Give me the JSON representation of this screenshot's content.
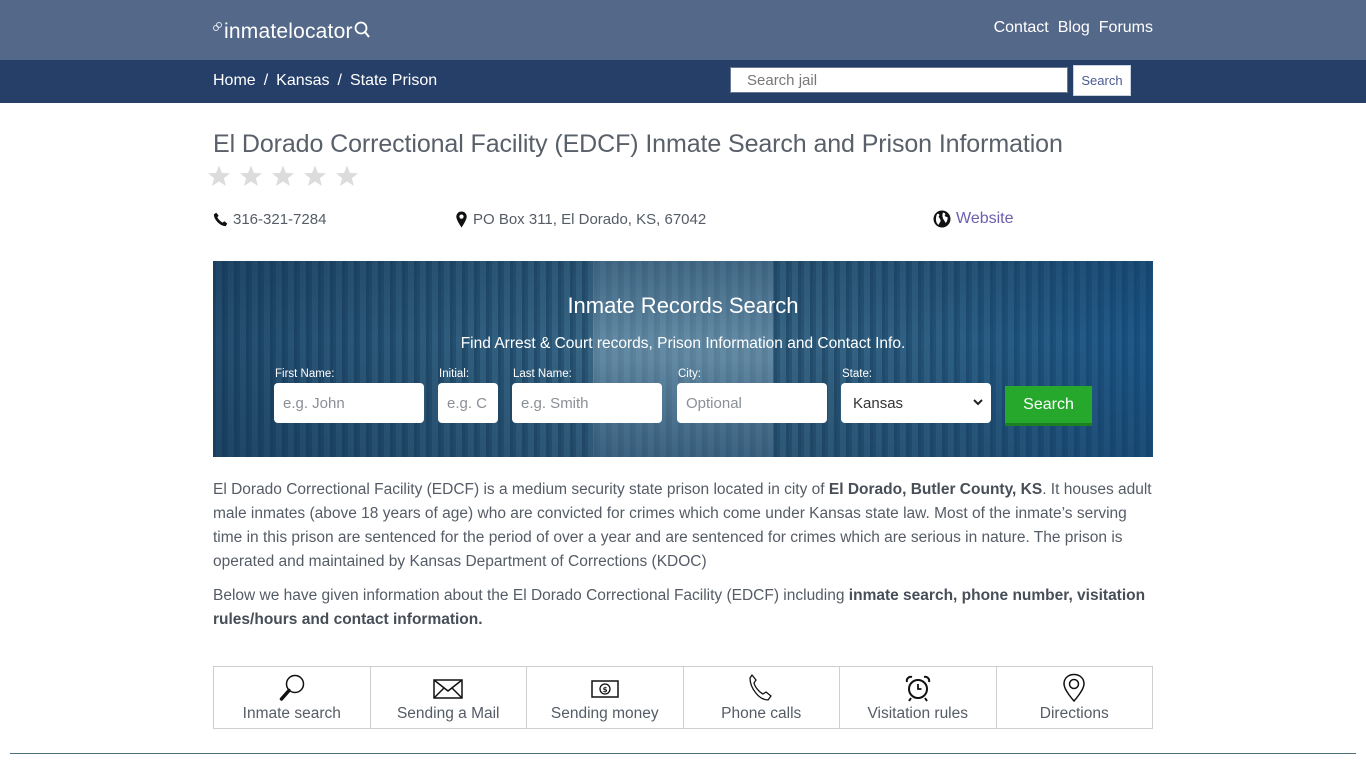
{
  "header": {
    "logo_text": "inmatelocator",
    "links": [
      "Contact",
      "Blog",
      "Forums"
    ]
  },
  "navbar": {
    "breadcrumb": [
      "Home",
      "Kansas",
      "State Prison"
    ],
    "breadcrumb_separator": "/",
    "search_placeholder": "Search jail",
    "search_value": "",
    "search_button": "Search"
  },
  "facility": {
    "title": "El Dorado Correctional Facility (EDCF) Inmate Search and Prison Information",
    "rating": {
      "value": 0,
      "max": 5
    },
    "phone": "316-321-7284",
    "address": "PO Box 311, El Dorado, KS, 67042",
    "website_label": "Website"
  },
  "search_panel": {
    "title": "Inmate Records Search",
    "subtitle": "Find Arrest & Court records, Prison Information and Contact Info.",
    "fields": [
      {
        "label": "First Name:",
        "placeholder": "e.g. John",
        "value": ""
      },
      {
        "label": "Initial:",
        "placeholder": "e.g. C",
        "value": ""
      },
      {
        "label": "Last Name:",
        "placeholder": "e.g. Smith",
        "value": ""
      },
      {
        "label": "City:",
        "placeholder": "Optional",
        "value": ""
      }
    ],
    "state_label": "State:",
    "state_selected": "Kansas",
    "search_button": "Search"
  },
  "description": {
    "p1_a": "El Dorado Correctional Facility (EDCF) is a medium security state prison located in city of ",
    "p1_bold": "El Dorado, Butler County, KS",
    "p1_b": ". It houses adult male inmates (above 18 years of age) who are convicted for crimes which come under Kansas state law. Most of the inmate’s serving time in this prison are sentenced for the period of over a year and are sentenced for crimes which are serious in nature. The prison is operated and maintained by Kansas Department of Corrections (KDOC)",
    "p2_a": "Below we have given information about the El Dorado Correctional Facility (EDCF) including ",
    "p2_bold": "inmate search, phone number, visitation rules/hours and contact information."
  },
  "tiles": [
    {
      "icon": "magnifier-icon",
      "label": "Inmate search"
    },
    {
      "icon": "envelope-icon",
      "label": "Sending a Mail"
    },
    {
      "icon": "money-icon",
      "label": "Sending money"
    },
    {
      "icon": "phone-icon",
      "label": "Phone calls"
    },
    {
      "icon": "alarm-clock-icon",
      "label": "Visitation rules"
    },
    {
      "icon": "map-pin-icon",
      "label": "Directions"
    }
  ],
  "colors": {
    "topbar": "#546889",
    "navbar": "#253f68",
    "search_button_green": "#26a82c",
    "link_purple": "#6a5fb0",
    "star_empty": "#dcdcdc"
  }
}
